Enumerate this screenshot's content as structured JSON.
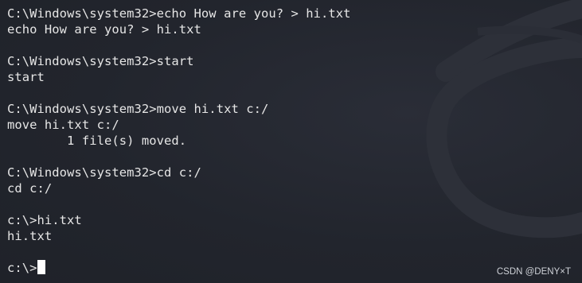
{
  "terminal": {
    "lines": [
      "C:\\Windows\\system32>echo How are you? > hi.txt",
      "echo How are you? > hi.txt",
      "",
      "C:\\Windows\\system32>start",
      "start",
      "",
      "C:\\Windows\\system32>move hi.txt c:/",
      "move hi.txt c:/",
      "        1 file(s) moved.",
      "",
      "C:\\Windows\\system32>cd c:/",
      "cd c:/",
      "",
      "c:\\>hi.txt",
      "hi.txt",
      ""
    ],
    "prompt": "c:\\>"
  },
  "watermark": "CSDN @DENY×T",
  "colors": {
    "background": "#23262f",
    "text": "#e6e6e6",
    "cursor": "#ffffff"
  }
}
